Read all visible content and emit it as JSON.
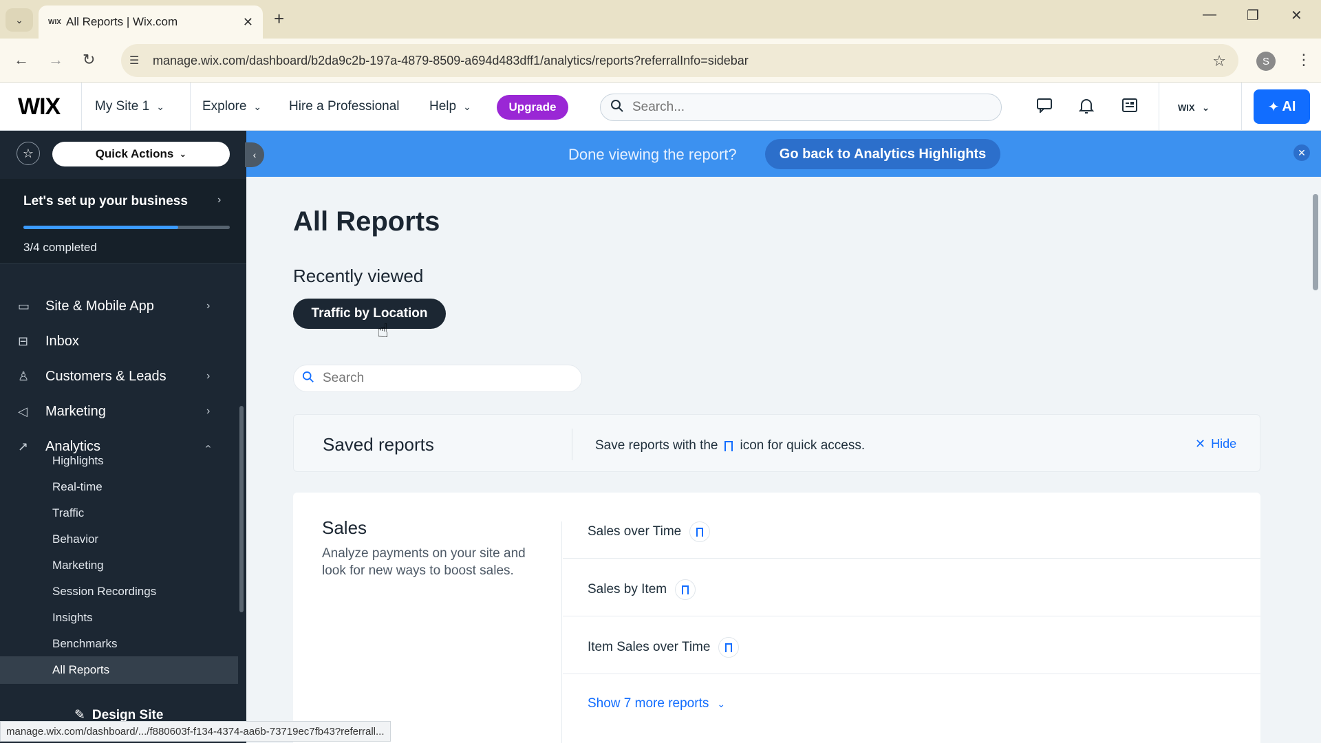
{
  "browser": {
    "tab_title": "All Reports | Wix.com",
    "tab_favicon": "WIX",
    "url": "manage.wix.com/dashboard/b2da9c2b-197a-4879-8509-a694d483dff1/analytics/reports?referralInfo=sidebar",
    "profile_initial": "S",
    "status_url": "manage.wix.com/dashboard/.../f880603f-f134-4374-aa6b-73719ec7fb43?referrall..."
  },
  "header": {
    "logo": "WIX",
    "site_selector": "My Site 1",
    "explore": "Explore",
    "hire": "Hire a Professional",
    "help": "Help",
    "upgrade": "Upgrade",
    "search_placeholder": "Search...",
    "account_label": "WIX",
    "ai_label": "AI",
    "accent_color": "#116dff",
    "upgrade_color": "#9a27d5"
  },
  "sidebar": {
    "quick_actions": "Quick Actions",
    "setup_title": "Let's set up your business",
    "setup_progress": "3/4 completed",
    "setup_fraction": 0.75,
    "items": [
      {
        "label": "Site & Mobile App",
        "icon": "site-icon"
      },
      {
        "label": "Inbox",
        "icon": "inbox-icon"
      },
      {
        "label": "Customers & Leads",
        "icon": "customers-icon"
      },
      {
        "label": "Marketing",
        "icon": "megaphone-icon"
      },
      {
        "label": "Analytics",
        "icon": "analytics-icon"
      }
    ],
    "analytics_sub": [
      "Highlights",
      "Real-time",
      "Traffic",
      "Behavior",
      "Marketing",
      "Session Recordings",
      "Insights",
      "Benchmarks",
      "All Reports"
    ],
    "selected_sub": "All Reports",
    "design_site": "Design Site"
  },
  "banner": {
    "text": "Done viewing the report?",
    "button": "Go back to Analytics Highlights"
  },
  "main": {
    "title": "All Reports",
    "recent_title": "Recently viewed",
    "recent_chip": "Traffic by Location",
    "search_placeholder": "Search",
    "saved": {
      "title": "Saved reports",
      "text_before": "Save reports with the",
      "text_after": "icon for quick access.",
      "hide": "Hide"
    },
    "sales": {
      "title": "Sales",
      "description": "Analyze payments on your site and look for new ways to boost sales.",
      "reports": [
        "Sales over Time",
        "Sales by Item",
        "Item Sales over Time"
      ],
      "show_more": "Show 7 more reports"
    }
  }
}
